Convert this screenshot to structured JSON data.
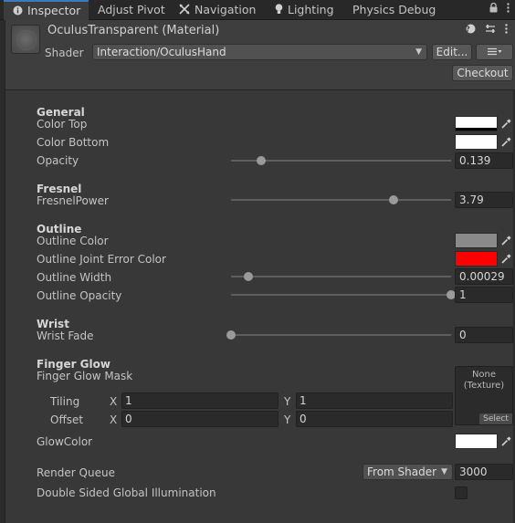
{
  "tabs": [
    {
      "label": "Inspector",
      "icon": "info-icon",
      "active": true
    },
    {
      "label": "Adjust Pivot",
      "icon": "",
      "active": false
    },
    {
      "label": "Navigation",
      "icon": "navigation-icon",
      "active": false
    },
    {
      "label": "Lighting",
      "icon": "bulb-icon",
      "active": false
    },
    {
      "label": "Physics Debug",
      "icon": "",
      "active": false
    }
  ],
  "tab_icons": {
    "lock": "🔒",
    "menu": "⋮"
  },
  "header": {
    "title": "OculusTransparent (Material)",
    "shader_label": "Shader",
    "shader_value": "Interaction/OculusHand",
    "edit_label": "Edit...",
    "list_icon": "☰",
    "checkout_label": "Checkout"
  },
  "sections": {
    "general": {
      "title": "General",
      "color_top_label": "Color Top",
      "color_top_value": "#ffffff",
      "color_bottom_label": "Color Bottom",
      "color_bottom_value": "#ffffff",
      "opacity_label": "Opacity",
      "opacity_value": "0.139",
      "opacity_fraction": 0.139
    },
    "fresnel": {
      "title": "Fresnel",
      "power_label": "FresnelPower",
      "power_value": "3.79",
      "power_fraction": 0.74
    },
    "outline": {
      "title": "Outline",
      "color_label": "Outline Color",
      "color_value": "#8a8a8a",
      "joint_error_label": "Outline Joint Error Color",
      "joint_error_value": "#ff0000",
      "width_label": "Outline Width",
      "width_value": "0.00029",
      "width_fraction": 0.08,
      "opacity_label": "Outline Opacity",
      "opacity_value": "1",
      "opacity_fraction": 1.0
    },
    "wrist": {
      "title": "Wrist",
      "fade_label": "Wrist Fade",
      "fade_value": "0",
      "fade_fraction": 0.0
    },
    "finger_glow": {
      "title": "Finger Glow",
      "mask_label": "Finger Glow Mask",
      "texture_none": "None",
      "texture_type": "(Texture)",
      "select_label": "Select",
      "tiling_label": "Tiling",
      "offset_label": "Offset",
      "x_label": "X",
      "y_label": "Y",
      "tiling_x": "1",
      "tiling_y": "1",
      "offset_x": "0",
      "offset_y": "0",
      "glow_color_label": "GlowColor",
      "glow_color_value": "#ffffff"
    }
  },
  "render_queue": {
    "label": "Render Queue",
    "mode": "From Shader",
    "value": "3000"
  },
  "double_sided": {
    "label": "Double Sided Global Illumination",
    "checked": false
  }
}
